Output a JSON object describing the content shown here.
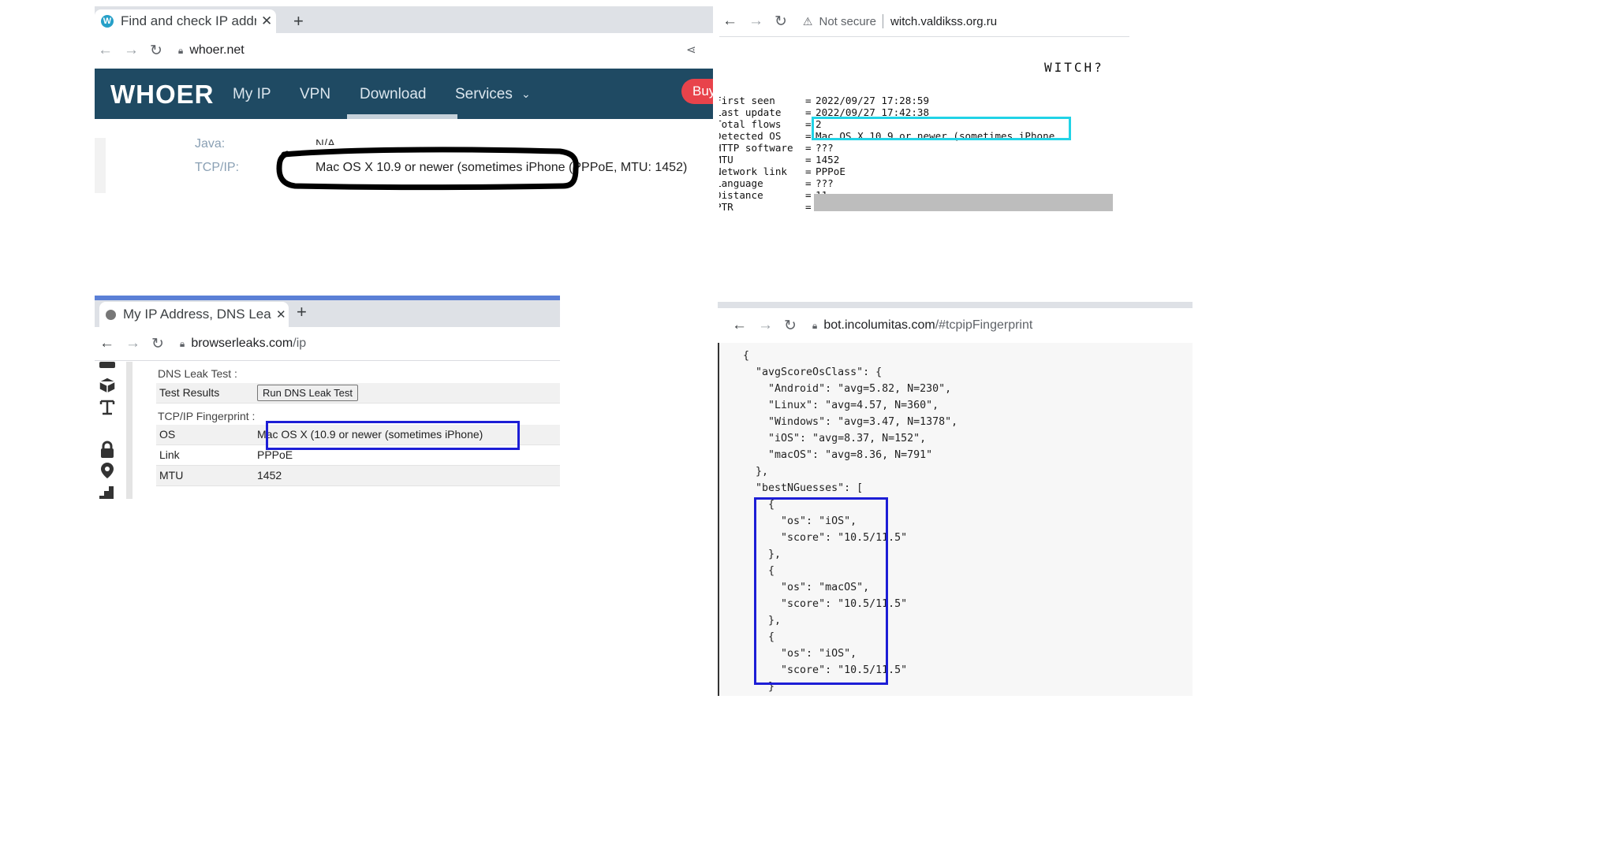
{
  "whoer": {
    "tab_title": "Find and check IP addr",
    "url": "whoer.net",
    "logo": "WHOER",
    "nav": [
      "My IP",
      "VPN",
      "Download",
      "Services"
    ],
    "buy": "Buy",
    "java_label": "Java:",
    "java_value": "N/A",
    "tcpip_label": "TCP/IP:",
    "tcpip_value": "Mac OS X 10.9 or newer (sometimes iPhone (PPPoE, MTU: 1452)"
  },
  "witch": {
    "security_label": "Not secure",
    "url": "witch.valdikss.org.ru",
    "title": "WITCH?",
    "rows": [
      {
        "key": "First seen",
        "value": "2022/09/27 17:28:59"
      },
      {
        "key": "Last update",
        "value": "2022/09/27 17:42:38"
      },
      {
        "key": "Total flows",
        "value": "2"
      },
      {
        "key": "Detected OS",
        "value": "Mac OS X 10.9 or newer (sometimes iPhone"
      },
      {
        "key": "HTTP software",
        "value": "???"
      },
      {
        "key": "MTU",
        "value": "1452"
      },
      {
        "key": "Network link",
        "value": "PPPoE"
      },
      {
        "key": "Language",
        "value": "???"
      },
      {
        "key": "Distance",
        "value": "11"
      },
      {
        "key": "PTR",
        "value": ""
      }
    ]
  },
  "browserleaks": {
    "tab_title": "My IP Address, DNS Lea",
    "url_host": "browserleaks.com",
    "url_path": "/ip",
    "dns_section": "DNS Leak Test :",
    "test_results_label": "Test Results",
    "run_button": "Run DNS Leak Test",
    "tcp_section": "TCP/IP Fingerprint :",
    "rows": [
      {
        "key": "OS",
        "value": "Mac OS X (10.9 or newer (sometimes iPhone)"
      },
      {
        "key": "Link",
        "value": "PPPoE"
      },
      {
        "key": "MTU",
        "value": "1452"
      }
    ]
  },
  "incolumitas": {
    "url_host": "bot.incolumitas.com",
    "url_path": "/#tcpipFingerprint",
    "json_lines": [
      "{",
      "  \"avgScoreOsClass\": {",
      "    \"Android\": \"avg=5.82, N=230\",",
      "    \"Linux\": \"avg=4.57, N=360\",",
      "    \"Windows\": \"avg=3.47, N=1378\",",
      "    \"iOS\": \"avg=8.37, N=152\",",
      "    \"macOS\": \"avg=8.36, N=791\"",
      "  },",
      "  \"bestNGuesses\": [",
      "    {",
      "      \"os\": \"iOS\",",
      "      \"score\": \"10.5/11.5\"",
      "    },",
      "    {",
      "      \"os\": \"macOS\",",
      "      \"score\": \"10.5/11.5\"",
      "    },",
      "    {",
      "      \"os\": \"iOS\",",
      "      \"score\": \"10.5/11.5\"",
      "    }"
    ]
  },
  "colors": {
    "whoer_nav": "#1f4a63",
    "highlight_black": "#000000",
    "highlight_cyan": "#21d3e6",
    "highlight_blue": "#1d1ed6"
  }
}
